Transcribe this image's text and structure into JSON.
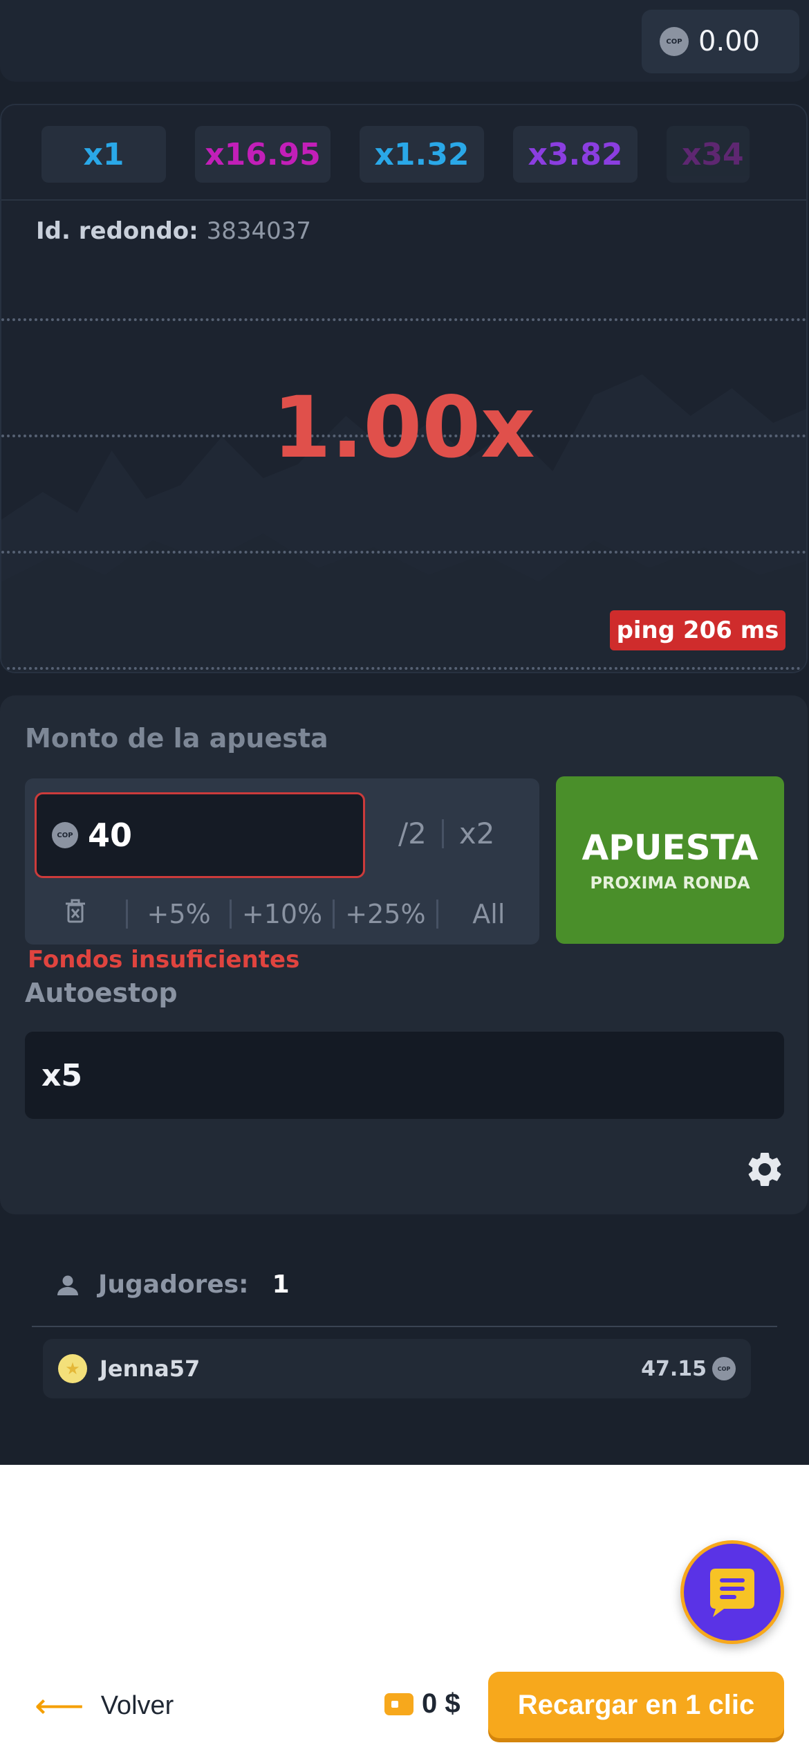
{
  "header": {
    "currency_code": "COP",
    "balance": "0.00"
  },
  "history": [
    {
      "label": "x1",
      "color": "#2aa8e8"
    },
    {
      "label": "x16.95",
      "color": "#c21fb8"
    },
    {
      "label": "x1.32",
      "color": "#2aa8e8"
    },
    {
      "label": "x3.82",
      "color": "#8b3ee0"
    },
    {
      "label": "x34",
      "color": "#8a2a9e"
    }
  ],
  "round": {
    "label": "Id. redondo:",
    "id": "3834037"
  },
  "game": {
    "multiplier": "1.00x",
    "ping": "ping 206 ms"
  },
  "bet": {
    "label": "Monto de la apuesta",
    "currency_code": "COP",
    "amount": "40",
    "half": "/2",
    "double": "x2",
    "quick": [
      "+5%",
      "+10%",
      "+25%",
      "All"
    ],
    "button_main": "APUESTA",
    "button_sub": "PROXIMA RONDA",
    "error": "Fondos insuficientes",
    "autostop_label": "Autoestop",
    "autostop_value": "x5"
  },
  "players": {
    "label": "Jugadores:",
    "count": "1",
    "list": [
      {
        "name": "Jenna57",
        "win": "47.15",
        "currency_code": "COP"
      }
    ]
  },
  "footer": {
    "back_label": "Volver",
    "cash": "0 $",
    "recharge_label": "Recargar en 1 clic"
  },
  "colors": {
    "accent_orange": "#f7a81c",
    "bet_green": "#4a8f2a",
    "multiplier_red": "#e0504b",
    "chat_purple": "#5a33e6"
  }
}
